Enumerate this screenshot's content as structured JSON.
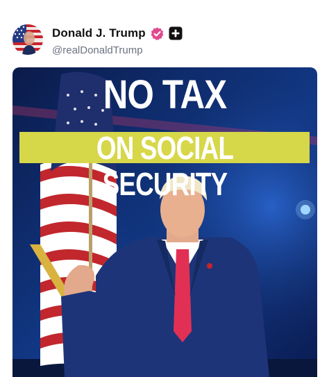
{
  "post": {
    "author": {
      "display_name": "Donald J. Trump",
      "handle": "@realDonaldTrump",
      "avatar_icon": "avatar-image",
      "verified_icon": "verified-badge-icon",
      "affiliate_icon": "affiliate-plus-icon"
    },
    "media": {
      "headline_line1": "NO TAX",
      "headline_line2": "ON SOCIAL SECURITY",
      "accent_color": "#d7d74a"
    }
  },
  "colors": {
    "verified_badge": "#e0498f",
    "affiliate_badge": "#111111",
    "handle_text": "#6b7280"
  }
}
